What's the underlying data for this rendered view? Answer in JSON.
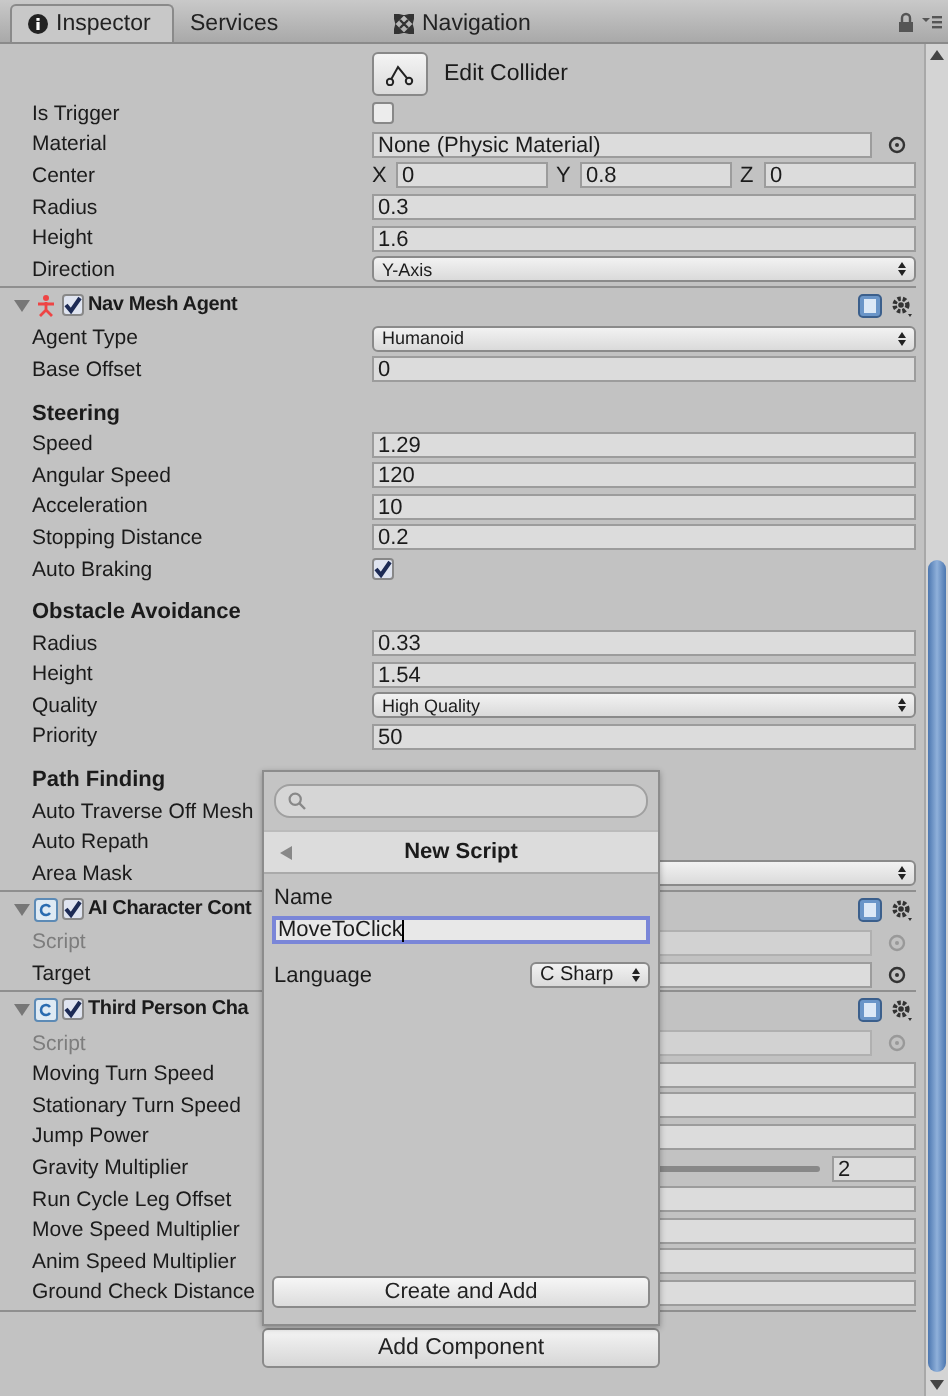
{
  "tabs": [
    {
      "label": "Inspector",
      "selected": true
    },
    {
      "label": "Services",
      "selected": false
    },
    {
      "label": "Navigation",
      "selected": false
    }
  ],
  "components": [
    {
      "rows": [
        {
          "kind": "button",
          "label": "Edit Collider"
        },
        {
          "kind": "checkbox",
          "label": "Is Trigger",
          "checked": false
        },
        {
          "kind": "object",
          "label": "Material",
          "value": "None (Physic Material)"
        },
        {
          "kind": "vector3",
          "label": "Center",
          "parts": [
            {
              "axis": "X",
              "value": "0"
            },
            {
              "axis": "Y",
              "value": "0.8"
            },
            {
              "axis": "Z",
              "value": "0"
            }
          ]
        },
        {
          "kind": "field",
          "label": "Radius",
          "value": "0.3"
        },
        {
          "kind": "field",
          "label": "Height",
          "value": "1.6"
        },
        {
          "kind": "dropdown",
          "label": "Direction",
          "value": "Y-Axis"
        }
      ]
    },
    {
      "title": "Nav Mesh Agent",
      "enabled": true,
      "rows": [
        {
          "kind": "dropdown",
          "label": "Agent Type",
          "value": "Humanoid"
        },
        {
          "kind": "field",
          "label": "Base Offset",
          "value": "0"
        },
        {
          "kind": "section",
          "label": "Steering"
        },
        {
          "kind": "field",
          "label": "Speed",
          "value": "1.29"
        },
        {
          "kind": "field",
          "label": "Angular Speed",
          "value": "120"
        },
        {
          "kind": "field",
          "label": "Acceleration",
          "value": "10"
        },
        {
          "kind": "field",
          "label": "Stopping Distance",
          "value": "0.2"
        },
        {
          "kind": "checkbox",
          "label": "Auto Braking",
          "checked": true
        },
        {
          "kind": "section",
          "label": "Obstacle Avoidance"
        },
        {
          "kind": "field",
          "label": "Radius",
          "value": "0.33"
        },
        {
          "kind": "field",
          "label": "Height",
          "value": "1.54"
        },
        {
          "kind": "dropdown",
          "label": "Quality",
          "value": "High Quality"
        },
        {
          "kind": "field",
          "label": "Priority",
          "value": "50"
        },
        {
          "kind": "section",
          "label": "Path Finding"
        },
        {
          "kind": "plain",
          "label": "Auto Traverse Off Mesh"
        },
        {
          "kind": "plain",
          "label": "Auto Repath"
        },
        {
          "kind": "dropdown",
          "label": "Area Mask"
        }
      ]
    },
    {
      "title": "AI Character Cont",
      "enabled": true,
      "rows": [
        {
          "kind": "object",
          "label": "Script",
          "disabled": true
        },
        {
          "kind": "object",
          "label": "Target",
          "disabled": false
        }
      ]
    },
    {
      "title": "Third Person Cha",
      "enabled": true,
      "rows": [
        {
          "kind": "object",
          "label": "Script",
          "disabled": true
        },
        {
          "kind": "field",
          "label": "Moving Turn Speed"
        },
        {
          "kind": "field",
          "label": "Stationary Turn Speed"
        },
        {
          "kind": "field",
          "label": "Jump Power"
        },
        {
          "kind": "slider",
          "label": "Gravity Multiplier",
          "value": "2"
        },
        {
          "kind": "field",
          "label": "Run Cycle Leg Offset"
        },
        {
          "kind": "field",
          "label": "Move Speed Multiplier"
        },
        {
          "kind": "field",
          "label": "Anim Speed Multiplier"
        },
        {
          "kind": "field",
          "label": "Ground Check Distance"
        }
      ]
    }
  ],
  "add_component": "Add Component",
  "popup": {
    "title": "New Script",
    "name_label": "Name",
    "name_value": "MoveToClick",
    "language_label": "Language",
    "language_value": "C Sharp",
    "create_button": "Create and Add"
  }
}
